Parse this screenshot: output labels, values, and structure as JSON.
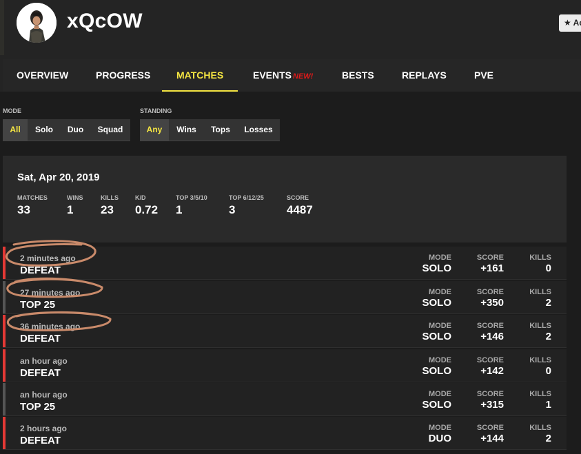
{
  "profile": {
    "username": "xQcOW",
    "add_button": "★ Ad"
  },
  "nav": {
    "items": [
      {
        "label": "OVERVIEW"
      },
      {
        "label": "PROGRESS"
      },
      {
        "label": "MATCHES"
      },
      {
        "label": "EVENTS",
        "badge": "NEW!"
      },
      {
        "label": "BESTS"
      },
      {
        "label": "REPLAYS"
      },
      {
        "label": "PVE"
      }
    ],
    "active": "MATCHES"
  },
  "filters": {
    "mode": {
      "label": "MODE",
      "options": [
        "All",
        "Solo",
        "Duo",
        "Squad"
      ],
      "selected": "All"
    },
    "standing": {
      "label": "STANDING",
      "options": [
        "Any",
        "Wins",
        "Tops",
        "Losses"
      ],
      "selected": "Any"
    }
  },
  "summary": {
    "date": "Sat, Apr 20, 2019",
    "stats": [
      {
        "label": "MATCHES",
        "value": "33"
      },
      {
        "label": "WINS",
        "value": "1"
      },
      {
        "label": "KILLS",
        "value": "23"
      },
      {
        "label": "K/D",
        "value": "0.72"
      },
      {
        "label": "TOP 3/5/10",
        "value": "1"
      },
      {
        "label": "TOP 6/12/25",
        "value": "3"
      },
      {
        "label": "SCORE",
        "value": "4487"
      }
    ]
  },
  "columns": {
    "mode": "MODE",
    "score": "SCORE",
    "kills": "KILLS"
  },
  "matches": [
    {
      "time": "2 minutes ago",
      "result": "DEFEAT",
      "mode": "SOLO",
      "score": "+161",
      "kills": "0"
    },
    {
      "time": "27 minutes ago",
      "result": "TOP 25",
      "mode": "SOLO",
      "score": "+350",
      "kills": "2"
    },
    {
      "time": "36 minutes ago",
      "result": "DEFEAT",
      "mode": "SOLO",
      "score": "+146",
      "kills": "2"
    },
    {
      "time": "an hour ago",
      "result": "DEFEAT",
      "mode": "SOLO",
      "score": "+142",
      "kills": "0"
    },
    {
      "time": "an hour ago",
      "result": "TOP 25",
      "mode": "SOLO",
      "score": "+315",
      "kills": "1"
    },
    {
      "time": "2 hours ago",
      "result": "DEFEAT",
      "mode": "DUO",
      "score": "+144",
      "kills": "2"
    }
  ],
  "colors": {
    "accent": "#f5e642",
    "defeat_bar": "#e53935",
    "top_bar": "#555555",
    "new_badge": "#e01919",
    "annotation": "#c98a6a"
  }
}
